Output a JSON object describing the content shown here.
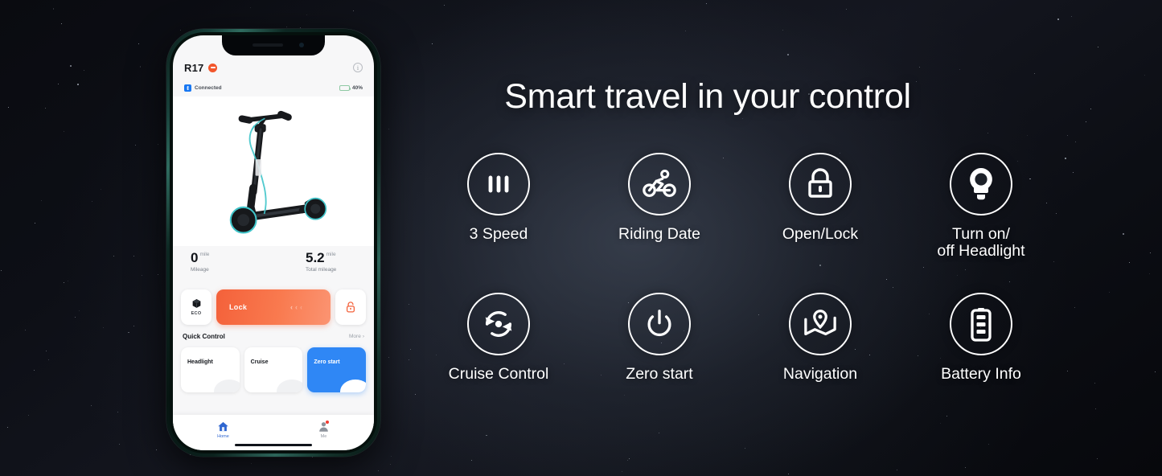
{
  "headline": "Smart travel in your control",
  "phone": {
    "app": {
      "header": {
        "device_name": "R17",
        "device_badge_icon": "minus-circle-icon",
        "info_icon": "info-icon"
      },
      "connection": {
        "bluetooth_icon": "bluetooth-icon",
        "status_text": "Connected",
        "battery_icon": "battery-icon",
        "battery_percent": "40%",
        "battery_level": 40
      },
      "product_image_alt": "electric-scooter",
      "stats": [
        {
          "value": "0",
          "unit": "mile",
          "label": "Mileage"
        },
        {
          "value": "5.2",
          "unit": "mile",
          "label": "Total mileage"
        }
      ],
      "lock_row": {
        "eco_icon": "cube-icon",
        "eco_label": "ECO",
        "slider_label": "Lock",
        "slider_chevrons": [
          "‹",
          "‹",
          "‹"
        ],
        "unlock_icon": "unlock-icon"
      },
      "quick_control": {
        "title": "Quick Control",
        "more_label": "More",
        "more_chevron": "›",
        "cards": [
          {
            "label": "Headlight",
            "active": false
          },
          {
            "label": "Cruise",
            "active": false
          },
          {
            "label": "Zero start",
            "active": true
          }
        ]
      },
      "tabbar": [
        {
          "label": "Home",
          "icon": "home-icon",
          "active": true,
          "badge": false
        },
        {
          "label": "Me",
          "icon": "person-icon",
          "active": false,
          "badge": true
        }
      ]
    }
  },
  "features": {
    "row1": [
      {
        "label": "3 Speed",
        "icon": "three-bars-icon"
      },
      {
        "label": "Riding Date",
        "icon": "cyclist-icon"
      },
      {
        "label": "Open/Lock",
        "icon": "padlock-icon"
      },
      {
        "label": "Turn on/\noff Headlight",
        "icon": "lightbulb-icon"
      }
    ],
    "row2": [
      {
        "label": "Cruise Control",
        "icon": "refresh-cycle-icon"
      },
      {
        "label": "Zero start",
        "icon": "power-icon"
      },
      {
        "label": "Navigation",
        "icon": "map-pin-icon"
      },
      {
        "label": "Battery Info",
        "icon": "battery-bars-icon"
      }
    ]
  },
  "colors": {
    "accent_orange": "#f4613a",
    "accent_blue": "#2f87f5",
    "badge_red": "#f23b30",
    "battery_green": "#49b06b",
    "bluetooth_blue": "#1877f2",
    "background_dark": "#0a0b10",
    "text_light": "#ffffff"
  }
}
